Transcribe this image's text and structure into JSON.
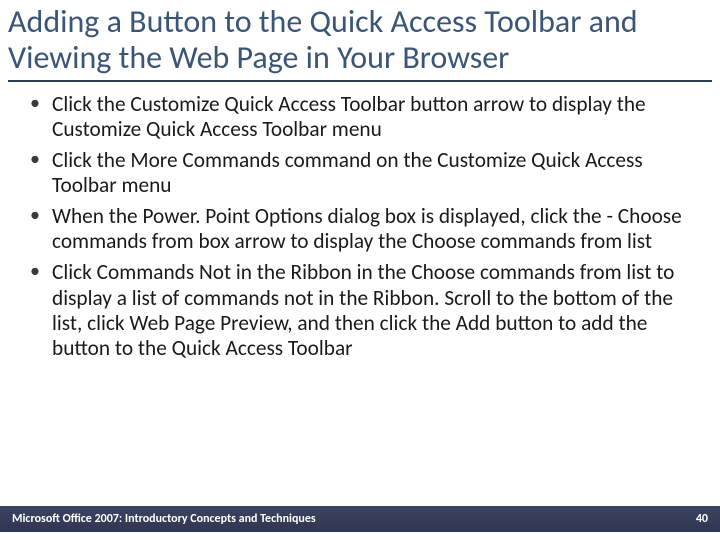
{
  "heading": "Adding a Button to the Quick Access Toolbar and Viewing the Web Page in Your Browser",
  "bullets": [
    "Click the Customize Quick Access Toolbar button arrow to display the Customize Quick Access Toolbar menu",
    "Click the More Commands command on the Customize Quick Access Toolbar menu",
    "When the Power. Point Options dialog box is displayed, click the - Choose commands from box arrow to display the Choose commands from list",
    "Click Commands Not in the Ribbon in the Choose commands from list to display a list of commands not in the Ribbon. Scroll to the bottom of the list, click Web Page Preview, and then click the Add button to add the button to the Quick Access Toolbar"
  ],
  "footer": {
    "left": "Microsoft Office 2007: Introductory Concepts and Techniques",
    "page": "40"
  }
}
